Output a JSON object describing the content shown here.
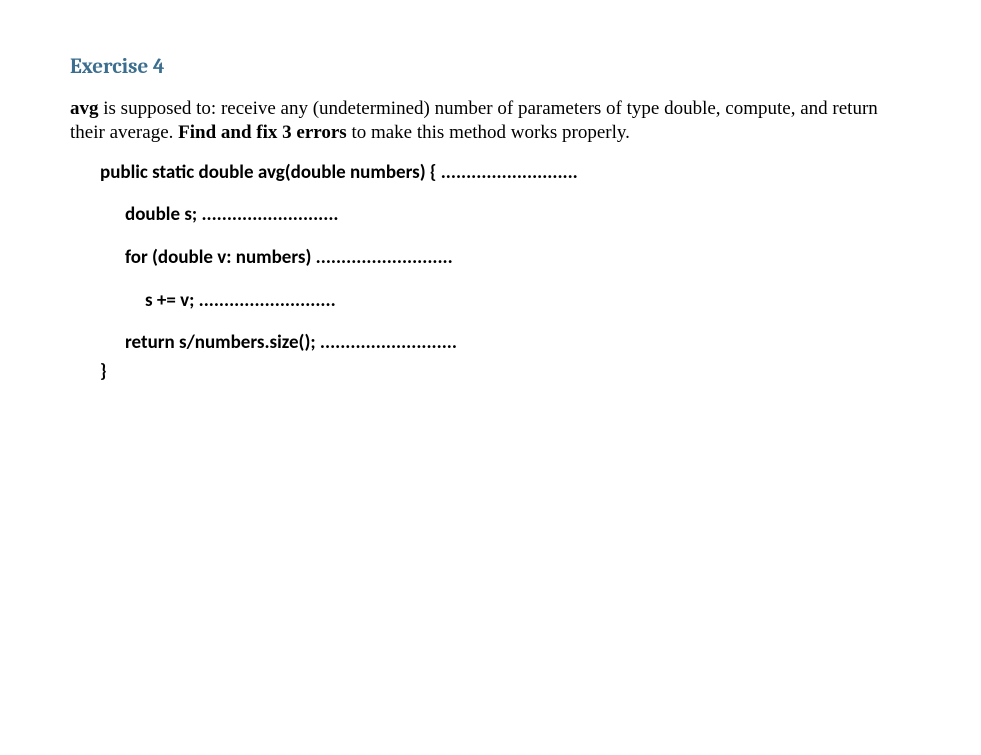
{
  "heading": "Exercise 4",
  "description": {
    "part1_bold": "avg",
    "part2": " is supposed to: receive any (undetermined) number of parameters of type double, compute, and return their average. ",
    "part3_bold": "Find and fix 3 errors",
    "part4": " to make this method works properly."
  },
  "code": {
    "line1": "public static double avg(double numbers) { ...........................",
    "line2": "double s; ...........................",
    "line3": "for (double v: numbers) ...........................",
    "line4": "s += v; ...........................",
    "line5": "return s/numbers.size(); ...........................",
    "line6": "}"
  }
}
